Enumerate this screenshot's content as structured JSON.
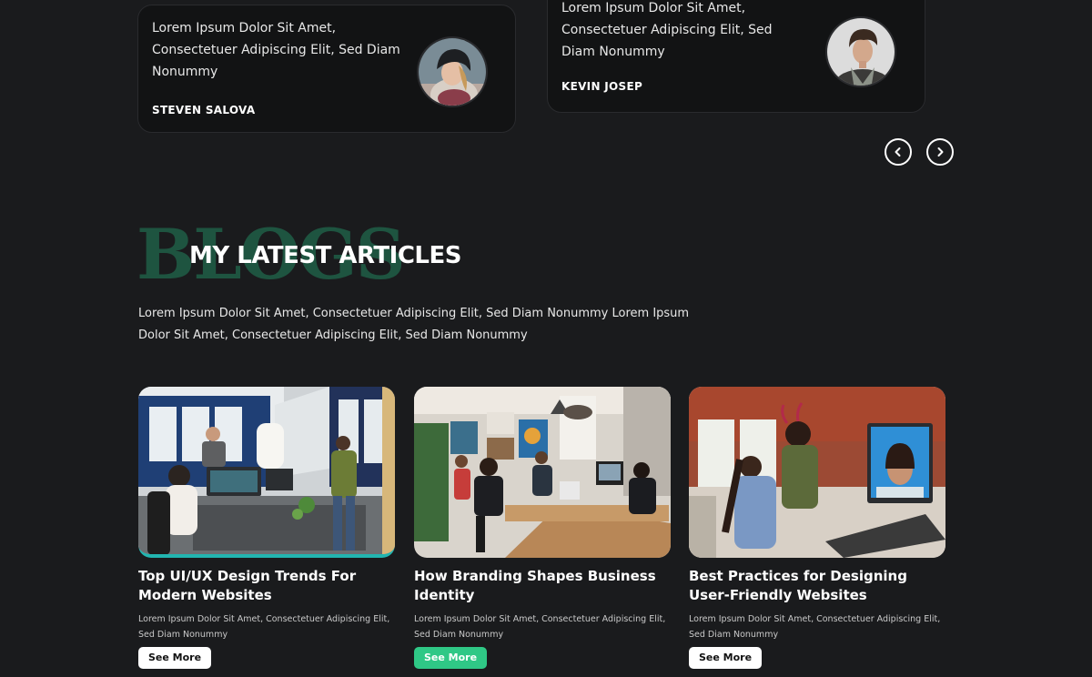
{
  "testimonials": [
    {
      "quote": "Lorem Ipsum Dolor Sit Amet, Consectetuer Adipiscing Elit, Sed Diam Nonummy",
      "name": "STEVEN SALOVA"
    },
    {
      "quote": "Lorem Ipsum Dolor Sit Amet, Consectetuer Adipiscing Elit, Sed Diam Nonummy",
      "name": "KEVIN JOSEP"
    }
  ],
  "blogs": {
    "background_word": "BLOGS",
    "title": "MY LATEST ARTICLES",
    "description": "Lorem Ipsum Dolor Sit Amet, Consectetuer Adipiscing Elit, Sed Diam Nonummy Lorem Ipsum Dolor Sit Amet, Consectetuer Adipiscing Elit, Sed Diam Nonummy",
    "articles": [
      {
        "title": "Top UI/UX Design Trends For Modern Websites",
        "excerpt": "Lorem Ipsum Dolor Sit Amet, Consectetuer Adipiscing Elit, Sed Diam Nonummy",
        "button": "See More"
      },
      {
        "title": "How Branding Shapes Business Identity",
        "excerpt": "Lorem Ipsum Dolor Sit Amet, Consectetuer Adipiscing Elit, Sed Diam Nonummy",
        "button": "See More"
      },
      {
        "title": "Best Practices for Designing User-Friendly Websites",
        "excerpt": "Lorem Ipsum Dolor Sit Amet, Consectetuer Adipiscing Elit, Sed Diam Nonummy",
        "button": "See More"
      }
    ]
  },
  "icons": {
    "prev": "chevron-left-icon",
    "next": "chevron-right-icon"
  },
  "colors": {
    "background": "#1a1b1d",
    "card": "#121314",
    "accent_green": "#2fc886",
    "accent_teal": "#22b5b0",
    "bg_word": "#1e5440"
  }
}
